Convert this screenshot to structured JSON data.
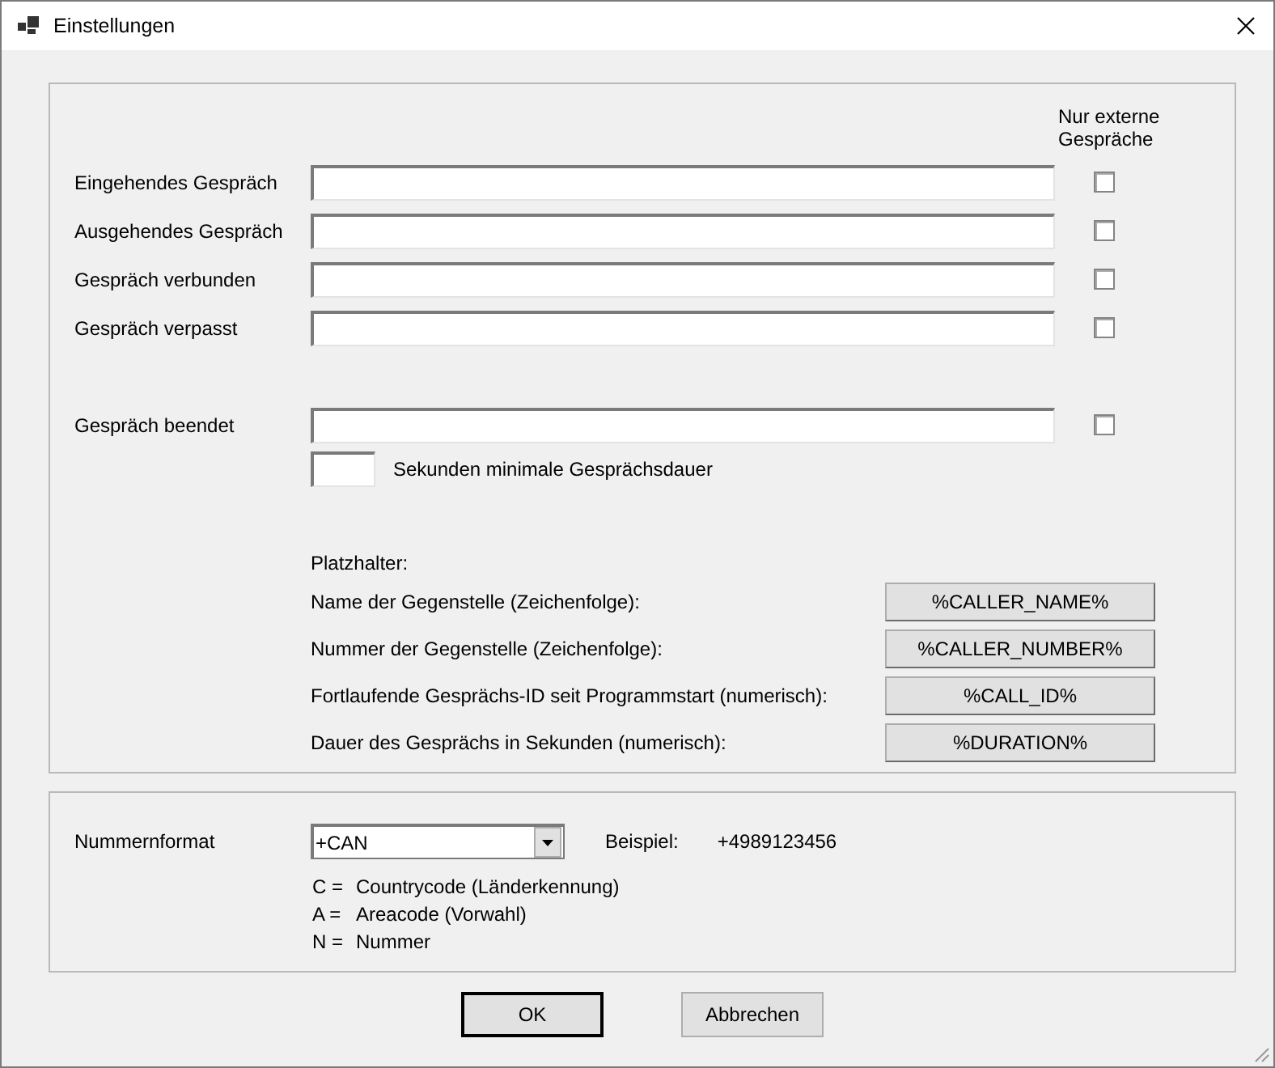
{
  "window": {
    "title": "Einstellungen"
  },
  "events": {
    "column_header": "Nur externe Gespräche",
    "rows": [
      {
        "label": "Eingehendes Gespräch",
        "checked": false
      },
      {
        "label": "Ausgehendes Gespräch",
        "checked": false
      },
      {
        "label": "Gespräch verbunden",
        "checked": false
      },
      {
        "label": "Gespräch verpasst",
        "checked": false
      }
    ],
    "ended": {
      "label": "Gespräch beendet",
      "checked": false
    },
    "min_duration_label": "Sekunden minimale Gesprächsdauer"
  },
  "placeholders": {
    "title": "Platzhalter:",
    "items": [
      {
        "description": "Name der Gegenstelle (Zeichenfolge):",
        "token": "%CALLER_NAME%"
      },
      {
        "description": "Nummer der Gegenstelle (Zeichenfolge):",
        "token": "%CALLER_NUMBER%"
      },
      {
        "description": "Fortlaufende Gesprächs-ID seit Programmstart (numerisch):",
        "token": "%CALL_ID%"
      },
      {
        "description": "Dauer des Gesprächs in Sekunden (numerisch):",
        "token": "%DURATION%"
      }
    ]
  },
  "number_format": {
    "label": "Nummernformat",
    "value": "+CAN",
    "example_label": "Beispiel:",
    "example": "+4989123456",
    "legend": [
      {
        "key": "C =",
        "text": "Countrycode (Länderkennung)"
      },
      {
        "key": "A =",
        "text": "Areacode (Vorwahl)"
      },
      {
        "key": "N =",
        "text": "Nummer"
      }
    ]
  },
  "buttons": [
    {
      "label": "OK",
      "default": true
    },
    {
      "label": "Abbrechen",
      "default": false
    }
  ]
}
